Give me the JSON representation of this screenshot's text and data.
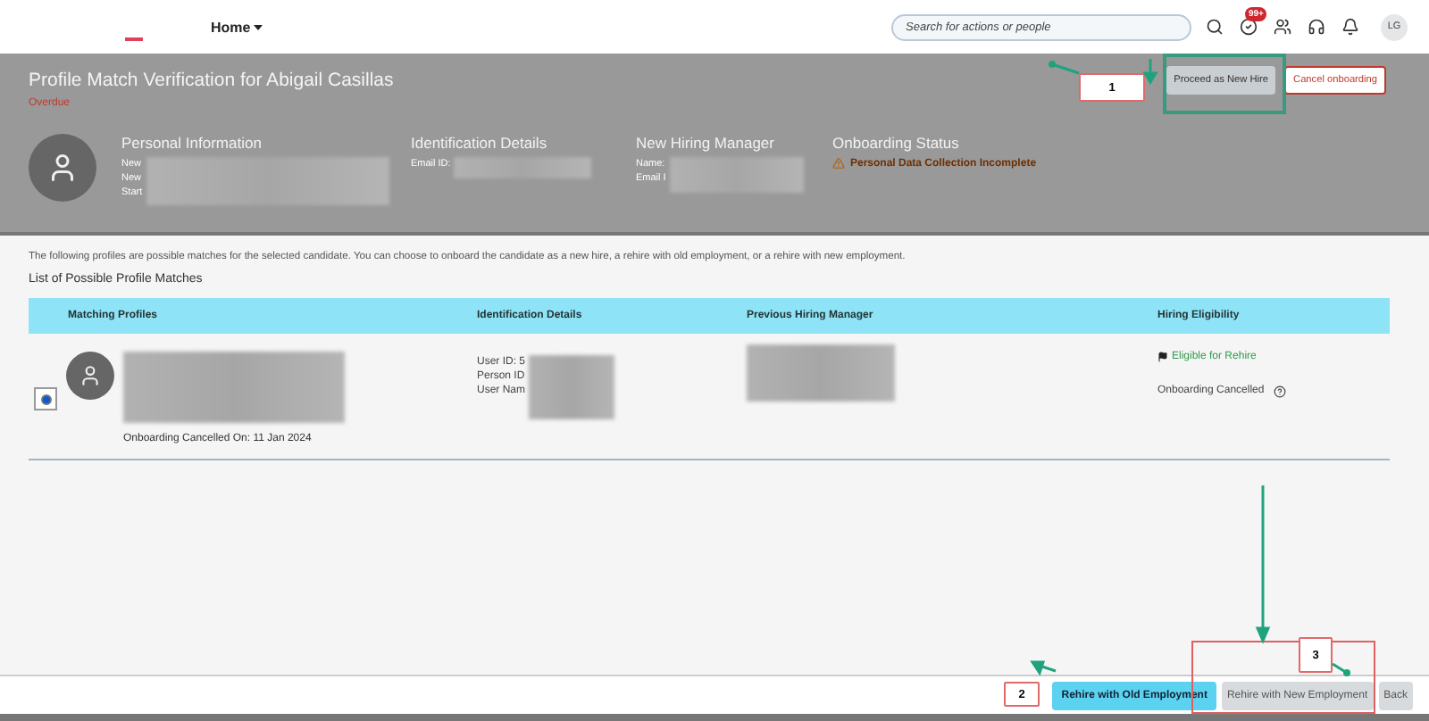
{
  "top_bar": {
    "home_menu": "Home",
    "search": {
      "placeholder": "Search for actions or people"
    },
    "notification_badge": "99+",
    "avatar_initials": "LG"
  },
  "header": {
    "title": "Profile Match Verification for Abigail Casillas",
    "status": "Overdue",
    "sections": [
      {
        "heading": "Personal Information",
        "lines": [
          "New",
          "New",
          "Start"
        ]
      },
      {
        "heading": "Identification Details",
        "lines": [
          "Email ID:"
        ]
      },
      {
        "heading": "New Hiring Manager",
        "lines": [
          "Name:",
          "Email I"
        ]
      },
      {
        "heading": "Onboarding Status",
        "warning": "Personal Data Collection Incomplete"
      }
    ],
    "buttons": [
      {
        "label": "Proceed as New Hire",
        "kind": "secondary"
      },
      {
        "label": "Cancel onboarding",
        "kind": "danger"
      }
    ]
  },
  "intro": "The following profiles are possible matches for the selected candidate. You can choose to onboard the candidate as a new hire, a rehire with old employment, or a rehire with new employment.",
  "list_title": "List of Possible Profile Matches",
  "table": {
    "columns": [
      "Matching Profiles",
      "Identification Details",
      "Previous Hiring Manager",
      "Hiring Eligibility"
    ],
    "rows": [
      {
        "selected": true,
        "note": "Onboarding Cancelled On: 11 Jan 2024",
        "id_lines": [
          "User ID: 5",
          "Person ID",
          "User Nam"
        ],
        "eligibility": "Eligible for Rehire",
        "eligibility_note": "Onboarding Cancelled"
      }
    ]
  },
  "footer_buttons": [
    {
      "label": "Rehire with Old Employment",
      "kind": "primary"
    },
    {
      "label": "Rehire with New Employment",
      "kind": "secondary"
    },
    {
      "label": "Back",
      "kind": "secondary"
    }
  ],
  "callouts": [
    "1",
    "2",
    "3"
  ]
}
